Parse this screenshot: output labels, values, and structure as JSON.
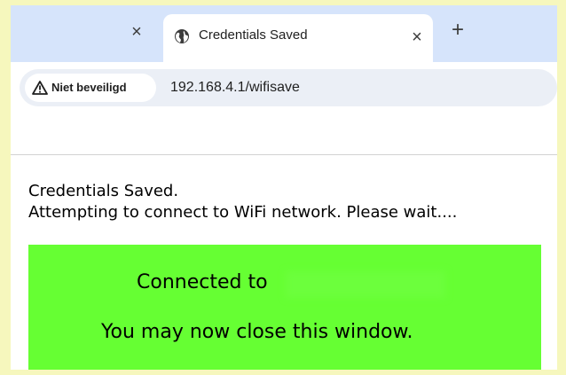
{
  "browser": {
    "tabs": [
      {
        "label": "",
        "state": "inactive"
      },
      {
        "label": "Credentials Saved",
        "state": "active"
      }
    ],
    "close_glyph": "×",
    "new_tab_glyph": "+",
    "security_label": "Niet beveiligd",
    "url": "192.168.4.1/wifisave",
    "icons": {
      "tab": "globe-icon",
      "security": "warning-triangle-icon",
      "close": "close-icon",
      "new_tab": "plus-icon"
    }
  },
  "page": {
    "line1": "Credentials Saved.",
    "line2": "Attempting to connect to WiFi network. Please wait....",
    "status_box": {
      "connected_text": "Connected to",
      "close_text": "You may now close this window.",
      "color": "#66ff33"
    }
  },
  "colors": {
    "tabstrip": "#d6e4fb",
    "omnibox": "#ebeff6",
    "frame": "#f6f7bd"
  }
}
